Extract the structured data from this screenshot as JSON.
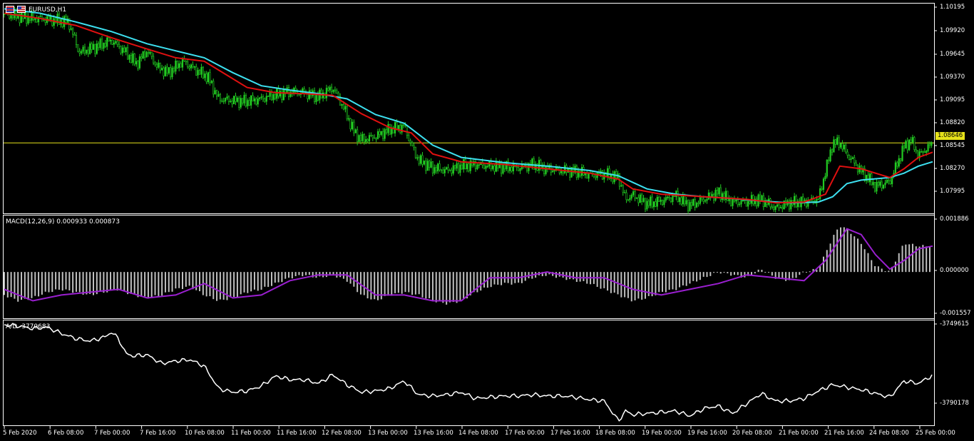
{
  "main": {
    "symbol": "EURUSD,H1",
    "current_price": "1.08646",
    "price_scale": [
      "1.10195",
      "1.09920",
      "1.09645",
      "1.09370",
      "1.09095",
      "1.08820",
      "1.08545",
      "1.08270",
      "1.07995"
    ],
    "colors": {
      "bull": "#22cc22",
      "bear": "#22cc22",
      "ma_fast": "#e01010",
      "ma_slow": "#3de0f0",
      "price_line": "#e6e21a",
      "background": "#000000",
      "grid": "#ffffff"
    }
  },
  "macd": {
    "title": "MACD(12,26,9) 0.000933 0.000873",
    "scale": [
      "0.001886",
      "0.000000",
      "-0.001557"
    ],
    "colors": {
      "histogram": "#c0c0c0",
      "signal": "#9a1fd0"
    }
  },
  "ad": {
    "title": "A/D -3770683",
    "scale": [
      "-3749615",
      "-3790178"
    ],
    "colors": {
      "line": "#ffffff"
    }
  },
  "time_axis": [
    "5 Feb 2020",
    "6 Feb 08:00",
    "7 Feb 00:00",
    "7 Feb 16:00",
    "10 Feb 08:00",
    "11 Feb 00:00",
    "11 Feb 16:00",
    "12 Feb 08:00",
    "13 Feb 00:00",
    "13 Feb 16:00",
    "14 Feb 08:00",
    "17 Feb 00:00",
    "17 Feb 16:00",
    "18 Feb 08:00",
    "19 Feb 00:00",
    "19 Feb 16:00",
    "20 Feb 08:00",
    "21 Feb 00:00",
    "21 Feb 16:00",
    "24 Feb 08:00",
    "25 Feb 00:00"
  ],
  "chart_data": [
    {
      "type": "candlestick",
      "title": "EURUSD,H1",
      "ylim": [
        1.0784,
        1.1024
      ],
      "series": [
        {
          "name": "price",
          "x": [
            0,
            30,
            60,
            90,
            105,
            130,
            150,
            170,
            185,
            200,
            215,
            230,
            250,
            270,
            285,
            300,
            320,
            340,
            360,
            380,
            400,
            420,
            440,
            460,
            475,
            490,
            500,
            520,
            540,
            560,
            570,
            580,
            600,
            620,
            640,
            660,
            680,
            700,
            720,
            740,
            760,
            780,
            800,
            820,
            840,
            860,
            870,
            880,
            900,
            920,
            940,
            960,
            980,
            1000,
            1020,
            1040,
            1060,
            1080,
            1100,
            1120,
            1140,
            1160,
            1170,
            1180,
            1200,
            1220,
            1240,
            1260,
            1270,
            1280,
            1300
          ],
          "y": [
            1.1012,
            1.1008,
            1.1006,
            1.1003,
            1.0968,
            1.0975,
            1.0982,
            1.0968,
            1.0955,
            1.097,
            1.0951,
            1.0945,
            1.0958,
            1.0947,
            1.094,
            1.0915,
            1.0913,
            1.0912,
            1.0915,
            1.092,
            1.0923,
            1.0922,
            1.0917,
            1.0928,
            1.0905,
            1.0877,
            1.0868,
            1.0872,
            1.088,
            1.0884,
            1.0862,
            1.0845,
            1.0836,
            1.0833,
            1.0838,
            1.084,
            1.0838,
            1.0837,
            1.0836,
            1.084,
            1.0835,
            1.0833,
            1.0832,
            1.0828,
            1.0829,
            1.0825,
            1.08,
            1.0805,
            1.0795,
            1.0798,
            1.0804,
            1.0793,
            1.08,
            1.0808,
            1.0797,
            1.0797,
            1.08,
            1.079,
            1.0796,
            1.0797,
            1.08,
            1.0864,
            1.0865,
            1.0852,
            1.0832,
            1.0815,
            1.082,
            1.086,
            1.0868,
            1.085,
            1.0864
          ]
        },
        {
          "name": "ma_fast",
          "x": [
            0,
            50,
            100,
            150,
            200,
            240,
            280,
            300,
            340,
            380,
            420,
            460,
            500,
            540,
            570,
            600,
            640,
            700,
            760,
            820,
            860,
            880,
            920,
            960,
            1000,
            1040,
            1080,
            1120,
            1150,
            1170,
            1200,
            1240,
            1260,
            1280,
            1300
          ],
          "y": [
            1.1013,
            1.1007,
            1.0999,
            1.0985,
            1.0972,
            1.0962,
            1.0958,
            1.0948,
            1.0928,
            1.0922,
            1.0921,
            1.0919,
            1.0898,
            1.0882,
            1.0876,
            1.0852,
            1.0843,
            1.084,
            1.0835,
            1.083,
            1.0823,
            1.0812,
            1.0806,
            1.0804,
            1.0802,
            1.08,
            1.0796,
            1.0797,
            1.0806,
            1.0838,
            1.0835,
            1.0825,
            1.0835,
            1.0848,
            1.0854
          ]
        },
        {
          "name": "ma_slow",
          "x": [
            0,
            50,
            100,
            150,
            200,
            240,
            280,
            320,
            360,
            400,
            440,
            480,
            520,
            560,
            600,
            640,
            700,
            760,
            820,
            860,
            900,
            940,
            980,
            1020,
            1060,
            1100,
            1140,
            1160,
            1180,
            1200,
            1240,
            1260,
            1280,
            1300
          ],
          "y": [
            1.1018,
            1.1013,
            1.1003,
            1.0992,
            1.0978,
            1.097,
            1.0962,
            1.0945,
            1.093,
            1.0925,
            1.0921,
            1.0915,
            1.0897,
            1.0887,
            1.0862,
            1.0848,
            1.0842,
            1.0838,
            1.0833,
            1.0827,
            1.0812,
            1.0806,
            1.0803,
            1.0801,
            1.0798,
            1.0796,
            1.0797,
            1.0803,
            1.0818,
            1.0822,
            1.0825,
            1.083,
            1.0838,
            1.0843
          ]
        }
      ]
    },
    {
      "type": "bar",
      "title": "MACD(12,26,9) 0.000933 0.000873",
      "ylim": [
        -0.001557,
        0.001886
      ],
      "series": [
        {
          "name": "histogram",
          "x": [
            0,
            20,
            40,
            60,
            80,
            100,
            120,
            140,
            160,
            180,
            200,
            220,
            240,
            260,
            280,
            300,
            320,
            340,
            360,
            380,
            400,
            420,
            440,
            460,
            480,
            500,
            520,
            540,
            560,
            580,
            600,
            620,
            640,
            660,
            680,
            700,
            720,
            740,
            760,
            780,
            800,
            820,
            840,
            860,
            880,
            900,
            920,
            940,
            960,
            980,
            1000,
            1020,
            1040,
            1060,
            1080,
            1100,
            1120,
            1140,
            1160,
            1170,
            1180,
            1200,
            1220,
            1240,
            1260,
            1280,
            1300
          ],
          "y": [
            -0.0008,
            -0.001,
            -0.0009,
            -0.0007,
            -0.0006,
            -0.0007,
            -0.0008,
            -0.0007,
            -0.0006,
            -0.0008,
            -0.0009,
            -0.0008,
            -0.0006,
            -0.0005,
            -0.0008,
            -0.001,
            -0.0009,
            -0.0007,
            -0.0006,
            -0.0004,
            -0.0002,
            -0.0001,
            -0.0002,
            -0.0001,
            -0.0003,
            -0.0008,
            -0.001,
            -0.0008,
            -0.0007,
            -0.0008,
            -0.001,
            -0.0011,
            -0.001,
            -0.0007,
            -0.0005,
            -0.0004,
            -0.0004,
            -0.0002,
            -0.0001,
            -0.0002,
            -0.0003,
            -0.0004,
            -0.0006,
            -0.0008,
            -0.001,
            -0.0009,
            -0.0007,
            -0.0006,
            -0.0004,
            -0.0002,
            0.0,
            -0.0001,
            -0.0002,
            0.0001,
            -0.0002,
            -0.0003,
            0.0,
            0.0001,
            0.0012,
            0.0016,
            0.0015,
            0.001,
            0.0002,
            0.0,
            0.001,
            0.0009,
            0.0009
          ]
        },
        {
          "name": "signal",
          "x": [
            0,
            40,
            80,
            120,
            160,
            200,
            240,
            280,
            320,
            360,
            400,
            440,
            480,
            520,
            560,
            600,
            640,
            680,
            720,
            760,
            800,
            840,
            880,
            920,
            960,
            1000,
            1040,
            1080,
            1120,
            1150,
            1180,
            1200,
            1220,
            1240,
            1260,
            1280,
            1300
          ],
          "y": [
            -0.0006,
            -0.001,
            -0.0008,
            -0.0007,
            -0.0006,
            -0.0009,
            -0.0008,
            -0.0004,
            -0.0009,
            -0.0008,
            -0.0003,
            -0.0001,
            -0.0001,
            -0.0008,
            -0.0008,
            -0.001,
            -0.001,
            -0.0002,
            -0.0002,
            0.0,
            -0.0002,
            -0.0002,
            -0.0006,
            -0.0008,
            -0.0006,
            -0.0004,
            -0.0001,
            -0.0002,
            -0.0003,
            0.0004,
            0.0015,
            0.0013,
            0.0006,
            0.0001,
            0.0004,
            0.0008,
            0.0009
          ]
        }
      ]
    },
    {
      "type": "line",
      "title": "A/D -3770683",
      "ylim": [
        -3790178,
        -3749615
      ],
      "series": [
        {
          "name": "A/D",
          "x": [
            0,
            20,
            40,
            60,
            80,
            100,
            120,
            140,
            150,
            160,
            170,
            180,
            200,
            220,
            240,
            260,
            280,
            300,
            320,
            340,
            360,
            380,
            400,
            420,
            440,
            460,
            480,
            500,
            520,
            540,
            560,
            580,
            600,
            620,
            640,
            660,
            680,
            700,
            720,
            740,
            760,
            780,
            800,
            820,
            840,
            860,
            870,
            880,
            900,
            920,
            940,
            960,
            980,
            1000,
            1020,
            1040,
            1060,
            1080,
            1100,
            1120,
            1140,
            1160,
            1180,
            1200,
            1220,
            1240,
            1260,
            1280,
            1300
          ],
          "y": [
            -3750500,
            -3751000,
            -3752000,
            -3751500,
            -3754000,
            -3756000,
            -3757000,
            -3755500,
            -3753500,
            -3756000,
            -3762000,
            -3763000,
            -3762500,
            -3766000,
            -3765000,
            -3764500,
            -3767000,
            -3776000,
            -3777500,
            -3777000,
            -3775000,
            -3771000,
            -3772500,
            -3772500,
            -3774000,
            -3770500,
            -3774500,
            -3777500,
            -3777000,
            -3776000,
            -3773000,
            -3778500,
            -3779000,
            -3778500,
            -3777500,
            -3780000,
            -3779500,
            -3779000,
            -3779000,
            -3778500,
            -3779000,
            -3779000,
            -3779500,
            -3780500,
            -3781000,
            -3789000,
            -3785000,
            -3786500,
            -3786000,
            -3785500,
            -3785000,
            -3787000,
            -3784000,
            -3783000,
            -3786000,
            -3782000,
            -3778000,
            -3781000,
            -3781000,
            -3780000,
            -3777000,
            -3774500,
            -3775500,
            -3776500,
            -3778000,
            -3779500,
            -3773000,
            -3774000,
            -3770700
          ]
        }
      ]
    }
  ]
}
